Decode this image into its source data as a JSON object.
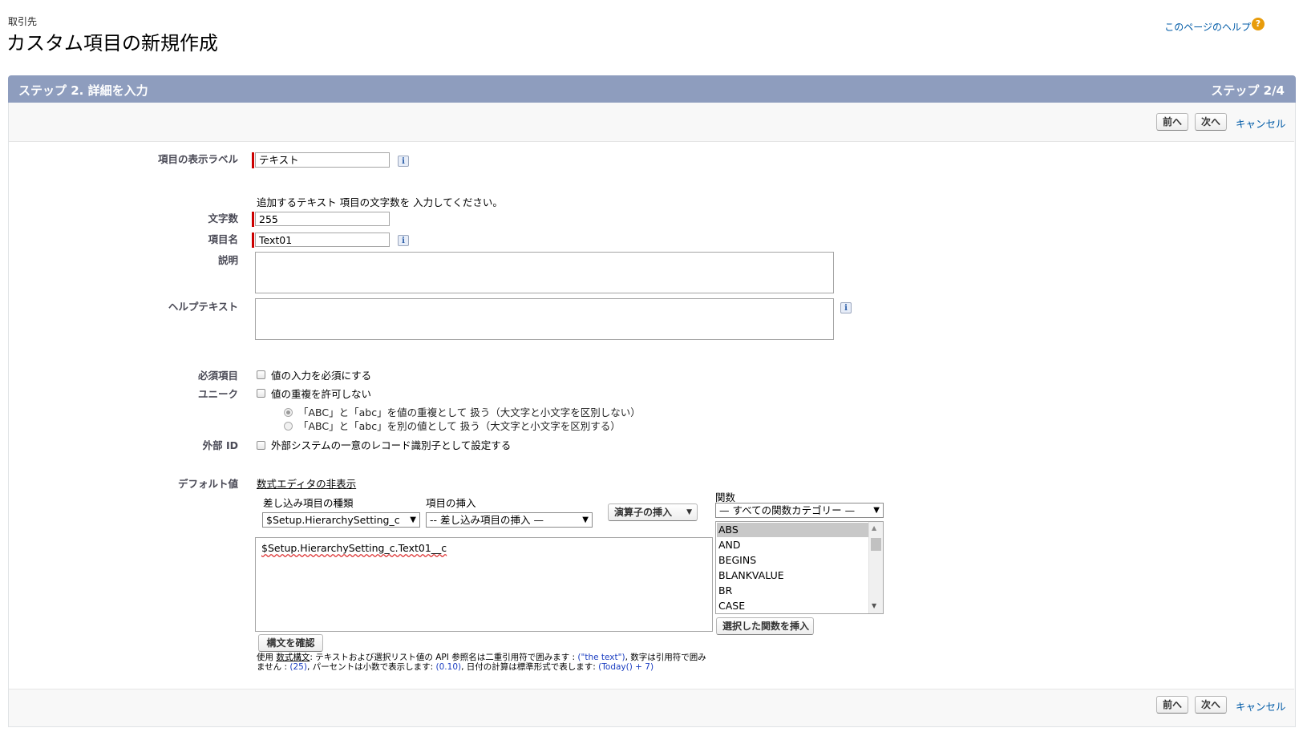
{
  "header": {
    "breadcrumb": "取引先",
    "title": "カスタム項目の新規作成",
    "help_link": "このページのヘルプ",
    "help_icon": "?"
  },
  "step_bar": {
    "left": "ステップ 2. 詳細を入力",
    "right": "ステップ 2/4"
  },
  "buttons": {
    "prev": "前へ",
    "next": "次へ",
    "cancel": "キャンセル"
  },
  "form": {
    "field_label": {
      "label": "項目の表示ラベル",
      "value": "テキスト"
    },
    "length_hint": "追加するテキスト 項目の文字数を 入力してください。",
    "length": {
      "label": "文字数",
      "value": "255"
    },
    "field_name": {
      "label": "項目名",
      "value": "Text01"
    },
    "description": {
      "label": "説明",
      "value": ""
    },
    "help_text": {
      "label": "ヘルプテキスト",
      "value": ""
    },
    "required": {
      "label": "必須項目",
      "option": "値の入力を必須にする",
      "checked": false
    },
    "unique": {
      "label": "ユニーク",
      "option": "値の重複を許可しない",
      "checked": false,
      "radio_case_insensitive": "「ABC」と「abc」を値の重複として 扱う（大文字と小文字を区別しない）",
      "radio_case_sensitive": "「ABC」と「abc」を別の値として 扱う（大文字と小文字を区別する）"
    },
    "external_id": {
      "label": "外部 ID",
      "option": "外部システムの一意のレコード識別子として設定する",
      "checked": false
    },
    "default_value": {
      "label": "デフォルト値",
      "hide_editor_link": "数式エディタの非表示",
      "merge_type_label": "差し込み項目の種類",
      "merge_type_value": "$Setup.HierarchySetting_c",
      "insert_field_label": "項目の挿入",
      "insert_field_value": "-- 差し込み項目の挿入 —",
      "insert_operator": "演算子の挿入",
      "functions_label": "関数",
      "functions_category": "— すべての関数カテゴリー —",
      "function_list": [
        "ABS",
        "AND",
        "BEGINS",
        "BLANKVALUE",
        "BR",
        "CASE"
      ],
      "selected_function": "ABS",
      "insert_function_button": "選択した関数を挿入",
      "formula": "$Setup.HierarchySetting_c.Text01__c",
      "check_syntax_button": "構文を確認",
      "note_line1_a": "使用 ",
      "note_line1_link": "数式構文",
      "note_line1_b": ": テキストおよび選択リスト値の API 参照名は二重引用符で囲みます : ",
      "note_line1_ex": "(\"the text\")",
      "note_line1_c": ", 数字は引用符で囲み",
      "note_line2_a": "ません : ",
      "note_line2_ex1": "(25)",
      "note_line2_b": ", パーセントは小数で表示します: ",
      "note_line2_ex2": "(0.10)",
      "note_line2_c": ", 日付の計算は標準形式で表します: ",
      "note_line2_ex3": "(Today() + 7)"
    }
  }
}
